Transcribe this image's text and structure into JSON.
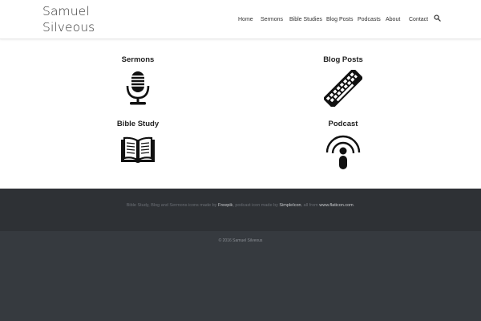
{
  "site": {
    "title": "Samuel Silveous"
  },
  "nav": {
    "items": [
      "Home",
      "Sermons",
      "Bible Studies",
      "Blog Posts",
      "Podcasts",
      "About",
      "Contact"
    ],
    "search_icon": "search-icon"
  },
  "sections": {
    "sermons": {
      "title": "Sermons",
      "icon": "microphone-icon"
    },
    "blog_posts": {
      "title": "Blog Posts",
      "icon": "keyboard-icon"
    },
    "bible_study": {
      "title": "Bible Study",
      "icon": "open-book-icon"
    },
    "podcast": {
      "title": "Podcast",
      "icon": "podcast-icon"
    }
  },
  "footer": {
    "credit_prefix": "Bible Study, Blog and Sermons icons made by ",
    "credit_freepik": "Freepik",
    "credit_mid": ", podcast icon made by ",
    "credit_simpleicon": "SimpleIcon",
    "credit_mid2": ", all from ",
    "credit_flaticon": "www.flaticon.com",
    "credit_end": ".",
    "copyright": "© 2016 Samuel Silveous"
  },
  "colors": {
    "footer_top": "#2e3135",
    "footer_bottom": "#363a3f",
    "text": "#222222"
  }
}
